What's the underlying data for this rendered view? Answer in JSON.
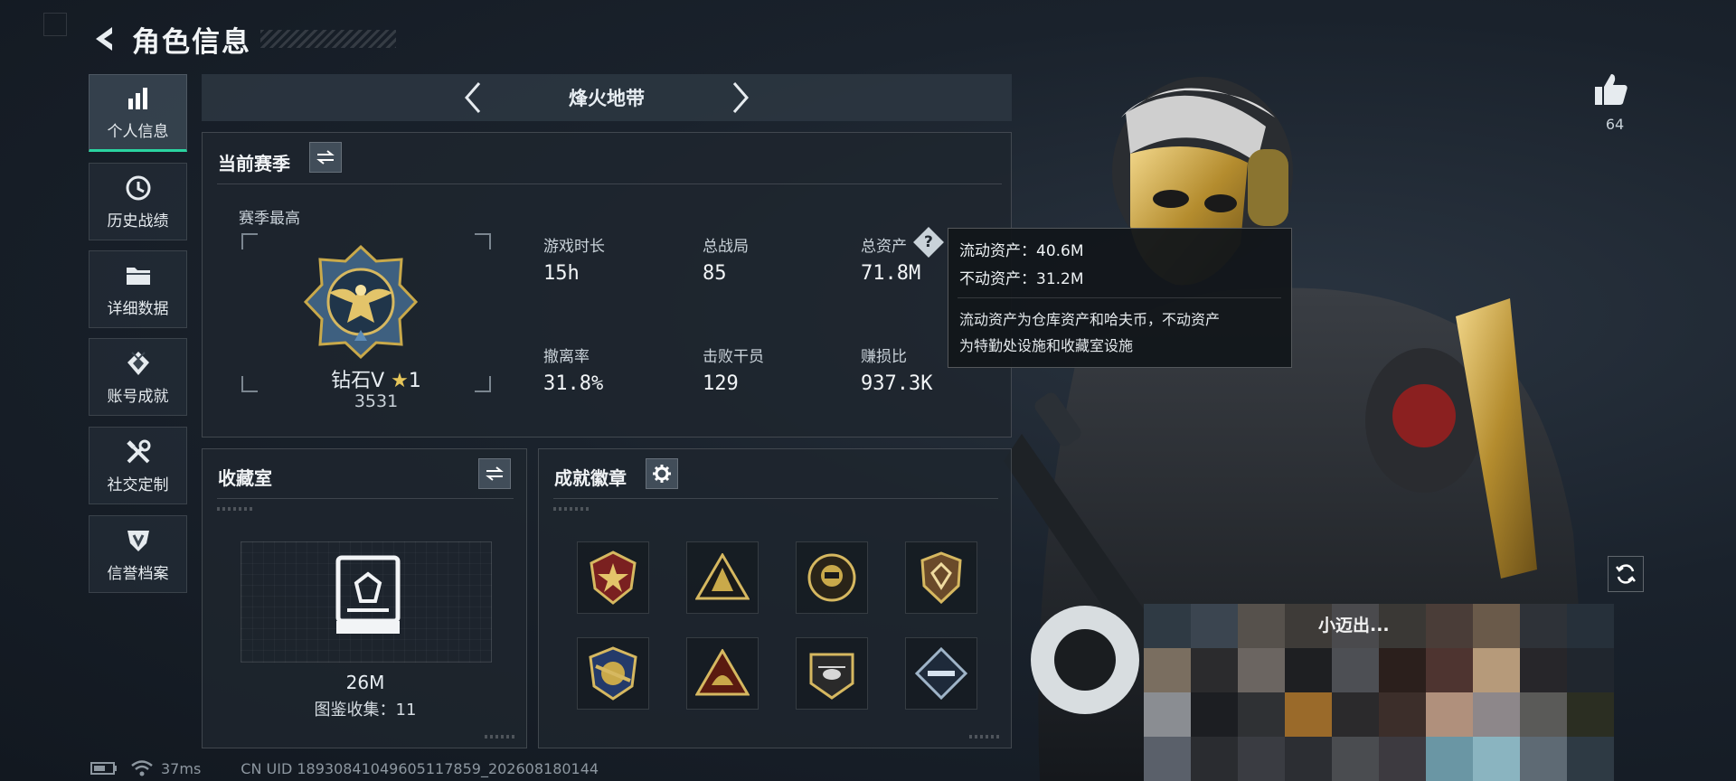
{
  "header": {
    "title": "角色信息"
  },
  "sidebar": {
    "items": [
      {
        "label": "个人信息",
        "icon": "bar-chart-icon",
        "active": true
      },
      {
        "label": "历史战绩",
        "icon": "history-icon",
        "active": false
      },
      {
        "label": "详细数据",
        "icon": "folder-icon",
        "active": false
      },
      {
        "label": "账号成就",
        "icon": "achievement-icon",
        "active": false
      },
      {
        "label": "社交定制",
        "icon": "tools-icon",
        "active": false
      },
      {
        "label": "信誉档案",
        "icon": "credit-shield-icon",
        "active": false
      }
    ]
  },
  "season_nav": {
    "mode": "烽火地带"
  },
  "current_season": {
    "title": "当前赛季",
    "peak_label": "赛季最高",
    "rank_name": "钻石V",
    "rank_stars": "1",
    "rank_points": "3531",
    "stats": [
      {
        "label": "游戏时长",
        "value": "15h"
      },
      {
        "label": "总战局",
        "value": "85"
      },
      {
        "label": "总资产",
        "value": "71.8M"
      },
      {
        "label": "撤离率",
        "value": "31.8%"
      },
      {
        "label": "击败干员",
        "value": "129"
      },
      {
        "label": "赚损比",
        "value": "937.3K"
      }
    ]
  },
  "tooltip": {
    "liquid": "流动资产：40.6M",
    "fixed": "不动资产：31.2M",
    "note_line1": "流动资产为仓库资产和哈夫币，不动资产",
    "note_line2": "为特勤处设施和收藏室设施"
  },
  "collection": {
    "title": "收藏室",
    "value": "26M",
    "caption": "图鉴收集：11"
  },
  "badges": {
    "title": "成就徽章",
    "items": [
      "star-shield-badge",
      "soldier-triangle-badge",
      "astronaut-badge",
      "shield-crest-badge",
      "eagle-crest-badge",
      "helmet-triangle-badge",
      "helicopter-badge",
      "rifle-diamond-badge"
    ]
  },
  "likes": {
    "count": "64"
  },
  "player": {
    "name_partial": "小迈出..."
  },
  "status_bar": {
    "ping": "37ms",
    "uid": "CN UID 1893084104960511785​9_202608180144"
  },
  "colors": {
    "accent": "#2ad4a0",
    "gold": "#c9a94a",
    "panel": "#1e262e"
  }
}
